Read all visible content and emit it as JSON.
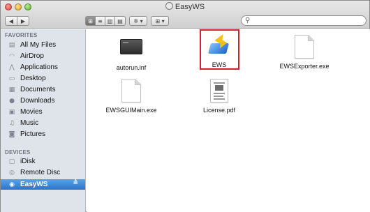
{
  "window": {
    "title": "EasyWS"
  },
  "toolbar": {
    "back": "◀",
    "forward": "▶",
    "view_icons": "⊞",
    "view_list": "≡",
    "view_columns": "▥",
    "view_coverflow": "▤",
    "action": "✲ ▾",
    "arrange": "⊞ ▾",
    "search": {
      "value": "",
      "placeholder": ""
    }
  },
  "sidebar": {
    "favorites_heading": "FAVORITES",
    "favorites": [
      {
        "label": "All My Files",
        "icon": "all-files-icon"
      },
      {
        "label": "AirDrop",
        "icon": "airdrop-icon"
      },
      {
        "label": "Applications",
        "icon": "applications-icon"
      },
      {
        "label": "Desktop",
        "icon": "desktop-icon"
      },
      {
        "label": "Documents",
        "icon": "documents-icon"
      },
      {
        "label": "Downloads",
        "icon": "downloads-icon"
      },
      {
        "label": "Movies",
        "icon": "movies-icon"
      },
      {
        "label": "Music",
        "icon": "music-icon"
      },
      {
        "label": "Pictures",
        "icon": "pictures-icon"
      }
    ],
    "devices_heading": "DEVICES",
    "devices": [
      {
        "label": "iDisk",
        "icon": "idisk-icon"
      },
      {
        "label": "Remote Disc",
        "icon": "remote-disc-icon"
      },
      {
        "label": "EasyWS",
        "icon": "drive-icon",
        "selected": true,
        "eject": "≜"
      }
    ]
  },
  "files": [
    {
      "name": "autorun.inf",
      "icon": "inf-file-icon"
    },
    {
      "name": "EWS",
      "icon": "ews-app-icon",
      "highlighted": true
    },
    {
      "name": "EWSExporter.exe",
      "icon": "document-icon"
    },
    {
      "name": "EWSGUIMain.exe",
      "icon": "document-icon"
    },
    {
      "name": "License.pdf",
      "icon": "pdf-icon"
    }
  ],
  "colors": {
    "selection": "#2e73c8",
    "highlight_box": "#d2232a",
    "sidebar_bg": "#dfe4ea"
  }
}
